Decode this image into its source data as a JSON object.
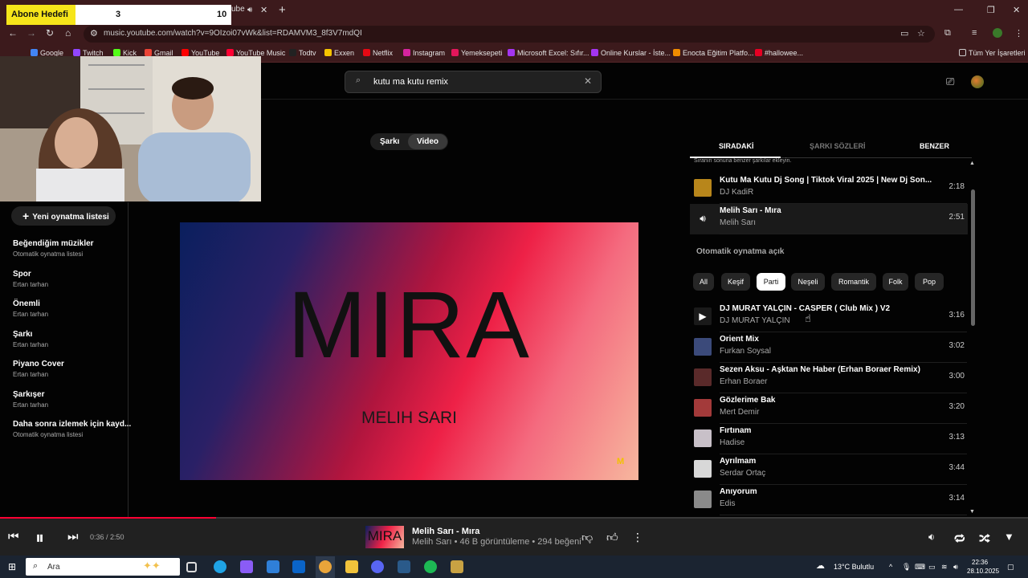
{
  "overlay": {
    "label": "Abone Hedefi",
    "current": "3",
    "goal": "10"
  },
  "browser": {
    "tab_fragment": "ube",
    "url": "music.youtube.com/watch?v=9OIzoi07vWk&list=RDAMVM3_8f3V7mdQI",
    "bookmarks": [
      {
        "label": "Google",
        "color": "#4285f4"
      },
      {
        "label": "Twitch",
        "color": "#9146ff"
      },
      {
        "label": "Kick",
        "color": "#53fc18"
      },
      {
        "label": "Gmail",
        "color": "#ea4335"
      },
      {
        "label": "YouTube",
        "color": "#ff0000"
      },
      {
        "label": "YouTube Music",
        "color": "#ff0033"
      },
      {
        "label": "Todtv",
        "color": "#222222"
      },
      {
        "label": "Exxen",
        "color": "#f5c400"
      },
      {
        "label": "Netflix",
        "color": "#e50914"
      },
      {
        "label": "Instagram",
        "color": "#d6249f"
      },
      {
        "label": "Yemeksepeti",
        "color": "#e3165b"
      },
      {
        "label": "Microsoft Excel: Sıfır...",
        "color": "#a435f0"
      },
      {
        "label": "Online Kurslar - İste...",
        "color": "#a435f0"
      },
      {
        "label": "Enocta Eğitim Platfo...",
        "color": "#f08c00"
      },
      {
        "label": "#hallowee...",
        "color": "#e60023"
      }
    ],
    "all_bookmarks": "Tüm Yer İşaretleri"
  },
  "search": {
    "query": "kutu ma kutu remix"
  },
  "sidebar": {
    "new_playlist": "Yeni oynatma listesi",
    "playlists": [
      {
        "title": "Beğendiğim müzikler",
        "sub": "Otomatik oynatma listesi"
      },
      {
        "title": "Spor",
        "sub": "Ertan tarhan"
      },
      {
        "title": "Önemli",
        "sub": "Ertan tarhan"
      },
      {
        "title": "Şarkı",
        "sub": "Ertan tarhan"
      },
      {
        "title": "Piyano Cover",
        "sub": "Ertan tarhan"
      },
      {
        "title": "Şarkışer",
        "sub": "Ertan tarhan"
      },
      {
        "title": "Daha sonra izlemek için kayd...",
        "sub": "Otomatik oynatma listesi"
      }
    ]
  },
  "toggle": {
    "song": "Şarkı",
    "video": "Video"
  },
  "video": {
    "title": "MIRA",
    "artist": "MELIH SARI",
    "mark": "M"
  },
  "panel": {
    "tabs": [
      "SIRADAKİ",
      "ŞARKI SÖZLERİ",
      "BENZER"
    ],
    "note": "Sıranın sonuna benzer şarkılar ekleyin.",
    "autoplay_label": "Otomatik oynatma açık",
    "chips": [
      "All",
      "Keşif",
      "Parti",
      "Neşeli",
      "Romantik",
      "Folk",
      "Pop"
    ],
    "active_chip": "Parti",
    "queue": [
      {
        "title": "Kutu Ma Kutu Dj Song | Tiktok Viral 2025 | New Dj Son...",
        "artist": "DJ KadiR",
        "duration": "2:18",
        "color": "#b8861b"
      },
      {
        "title": "Melih Sarı - Mıra",
        "artist": "Melih Sarı",
        "duration": "2:51",
        "color": "#1a1a1a"
      }
    ],
    "autoplay": [
      {
        "title": "DJ MURAT YALÇIN - CASPER ( Club Mix ) V2",
        "artist": "DJ MURAT YALÇIN",
        "duration": "3:16",
        "color": "#1a1a1a"
      },
      {
        "title": "Orient Mix",
        "artist": "Furkan Soysal",
        "duration": "3:02",
        "color": "#3b4a7a"
      },
      {
        "title": "Sezen Aksu - Aşktan Ne Haber (Erhan Boraer Remix)",
        "artist": "Erhan Boraer",
        "duration": "3:00",
        "color": "#5a2a2a"
      },
      {
        "title": "Gözlerime Bak",
        "artist": "Mert Demir",
        "duration": "3:20",
        "color": "#a33a3a"
      },
      {
        "title": "Fırtınam",
        "artist": "Hadise",
        "duration": "3:13",
        "color": "#c8c0c8"
      },
      {
        "title": "Ayrılmam",
        "artist": "Serdar Ortaç",
        "duration": "3:44",
        "color": "#d8d8d8"
      },
      {
        "title": "Anıyorum",
        "artist": "Edis",
        "duration": "3:14",
        "color": "#8a8a8a"
      }
    ]
  },
  "player": {
    "time": "0:36 / 2:50",
    "progress": 0.21,
    "now_title": "Melih Sarı - Mıra",
    "now_meta": "Melih Sarı • 46 B görüntüleme • 294 beğeni",
    "thumb_text": "MIRA"
  },
  "taskbar": {
    "search_placeholder": "Ara",
    "weather": "13°C Bulutlu",
    "time": "22:36",
    "date": "28.10.2025",
    "apps": [
      {
        "name": "task-view-icon",
        "color": "#dddddd"
      },
      {
        "name": "edge-icon",
        "color": "#1fa3e5"
      },
      {
        "name": "copilot-icon",
        "color": "#8a5cf6"
      },
      {
        "name": "store-icon",
        "color": "#2f7fd8"
      },
      {
        "name": "outlook-icon",
        "color": "#0a64c8"
      },
      {
        "name": "chrome-icon",
        "color": "#e9a43a"
      },
      {
        "name": "explorer-icon",
        "color": "#f0c23b"
      },
      {
        "name": "discord-icon",
        "color": "#5865f2"
      },
      {
        "name": "steam-icon",
        "color": "#2a5a8a"
      },
      {
        "name": "spotify-icon",
        "color": "#1db954"
      },
      {
        "name": "lol-icon",
        "color": "#c8a243"
      }
    ]
  }
}
